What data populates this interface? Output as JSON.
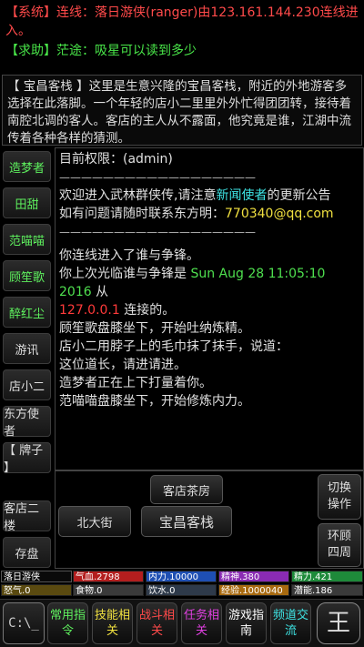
{
  "chat": {
    "system_prefix": "【系统】",
    "system_text": "连线：落日游侠(ranger)由123.161.144.230连线进入。",
    "help_prefix": "【求助】",
    "help_user": "茫途",
    "help_text": "：吸星可以读到多少"
  },
  "room": {
    "description": "【 宝昌客栈 】这里是生意兴隆的宝昌客栈，附近的外地游客多选择在此落脚。一个年轻的店小二里里外外忙得团团转，接待着南腔北调的客人。客店的主人从不露面，他究竟是谁，江湖中流传着各种各样的猜测。"
  },
  "left_buttons": [
    {
      "label": "造梦者",
      "color": "green"
    },
    {
      "label": "田甜",
      "color": "green"
    },
    {
      "label": "范喵喵",
      "color": "green"
    },
    {
      "label": "顾笙歌",
      "color": "green"
    },
    {
      "label": "醉红尘",
      "color": "green"
    },
    {
      "label": "游讯",
      "color": "white"
    },
    {
      "label": "店小二",
      "color": "white"
    },
    {
      "label": "东方使者",
      "color": "white"
    },
    {
      "label": "【 牌子 】",
      "color": "white"
    }
  ],
  "messages": {
    "perm": "目前权限：(admin)",
    "rule1": "——————————————————",
    "welcome_a": "欢迎进入武林群侠传,请注意",
    "welcome_b": "新闻使者",
    "welcome_c": "的更新公告",
    "contact_a": "如有问题请随时联系东方明：",
    "contact_b": "770340@qq.com",
    "rule2": "——————————————————",
    "line1": "你连线进入了谁与争锋。",
    "line2_a": "你上次光临谁与争锋是 ",
    "line2_b": "Sun Aug 28 11:05:10 2016",
    "line2_c": " 从",
    "line3_a": "127.0.0.1",
    "line3_b": " 连接的。",
    "line4": "顾笙歌盘膝坐下，开始吐纳炼精。",
    "line5": "店小二用脖子上的毛巾抹了抹手，说道：",
    "line6": "这位道长，请进请进。",
    "line7": "造梦者正在上下打量着你。",
    "line8": "范喵喵盘膝坐下，开始修炼内力。"
  },
  "exits": {
    "north": "客店茶房",
    "west": "北大街",
    "center": "宝昌客栈",
    "upstairs": "客店二楼",
    "save": "存盘",
    "switch": "切换操作",
    "look": "环顾四周"
  },
  "status": {
    "name": "落日游侠",
    "qixue": "气血.2798",
    "neili": "内力.10000",
    "jingshen": "精神.380",
    "jingli": "精力.421",
    "nuqi": "怒气.0",
    "food": "食物.0",
    "water": "饮水.0",
    "exp": "经验.1000040",
    "potential": "潜能.186"
  },
  "nav": {
    "terminal": "C:\\_",
    "common": "常用指令",
    "skills": "技能相关",
    "combat": "战斗相关",
    "quests": "任务相关",
    "guide": "游戏指南",
    "channel": "频道交流",
    "menu_icon": "mahjong-tile-icon",
    "menu_glyph": "王"
  },
  "colors": {
    "system": "#ff4a4a",
    "help": "#49e649",
    "cyan": "#3ee4e4",
    "yellow": "#f0e040",
    "qixue_bar": "#b31e1e",
    "neili_bar": "#1e4fb3",
    "jingshen_bar": "#8a2bb3",
    "jingli_bar": "#1e8a3a"
  }
}
